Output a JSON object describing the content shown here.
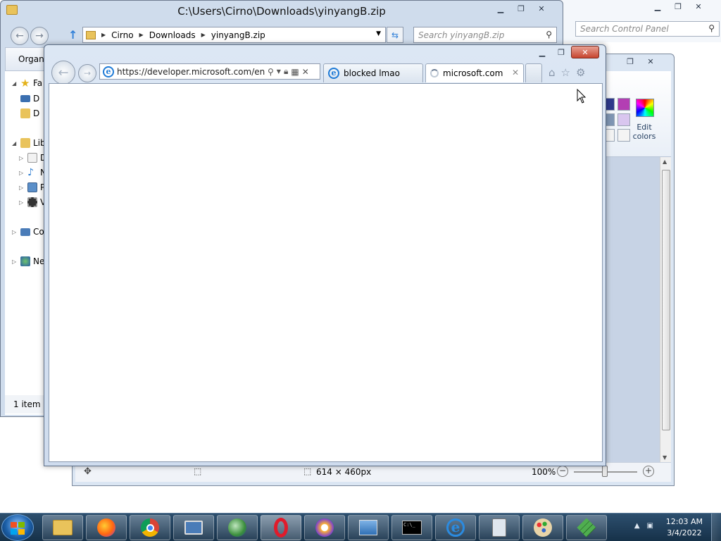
{
  "control_panel": {
    "search_placeholder": "Search Control Panel"
  },
  "explorer": {
    "title": "C:\\Users\\Cirno\\Downloads\\yinyangB.zip",
    "breadcrumb": [
      "Cirno",
      "Downloads",
      "yinyangB.zip"
    ],
    "search_placeholder": "Search yinyangB.zip",
    "organize_label": "Organi",
    "tree": [
      {
        "label": "Fa"
      },
      {
        "label": "D"
      },
      {
        "label": "D"
      },
      {
        "label": "Lib"
      },
      {
        "label": "D"
      },
      {
        "label": "N"
      },
      {
        "label": "Pi"
      },
      {
        "label": "V"
      },
      {
        "label": "Co"
      },
      {
        "label": "Ne"
      }
    ],
    "status": "1 item"
  },
  "paint": {
    "edit_colors_label": "Edit colors",
    "image_size": "614 × 460px",
    "zoom": "100%"
  },
  "ie": {
    "url": "https://developer.microsoft.com/en-u",
    "tabs": [
      {
        "label": "blocked lmao"
      },
      {
        "label": "microsoft.com"
      }
    ]
  },
  "taskbar": {
    "time": "12:03 AM",
    "date": "3/4/2022",
    "apps": [
      "windows-explorer",
      "firefox",
      "chrome",
      "remote-desktop",
      "network-globe",
      "opera",
      "brave",
      "control-panel",
      "command-prompt",
      "internet-explorer",
      "calculator",
      "paint",
      "rubiks-cube"
    ]
  },
  "colors": {
    "taskbar": "#1d3b58",
    "window_frame": "#cfdcee",
    "close_button": "#c7452f"
  }
}
